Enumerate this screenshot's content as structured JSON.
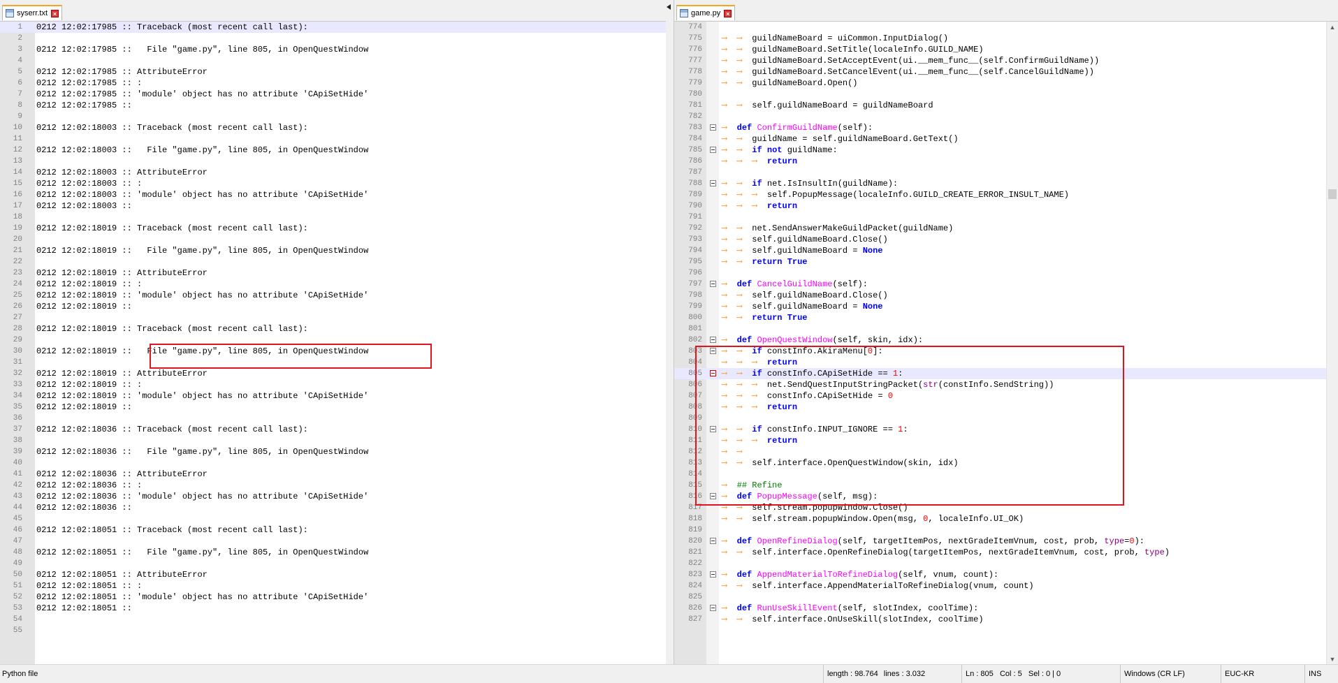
{
  "left_tab": {
    "label": "syserr.txt"
  },
  "right_tab": {
    "label": "game.py"
  },
  "left_lines": [
    {
      "n": "1",
      "t": "0212 12:02:17985 :: Traceback (most recent call last):"
    },
    {
      "n": "2",
      "t": ""
    },
    {
      "n": "3",
      "t": "0212 12:02:17985 ::   File \"game.py\", line 805, in OpenQuestWindow"
    },
    {
      "n": "4",
      "t": ""
    },
    {
      "n": "5",
      "t": "0212 12:02:17985 :: AttributeError"
    },
    {
      "n": "6",
      "t": "0212 12:02:17985 :: :"
    },
    {
      "n": "7",
      "t": "0212 12:02:17985 :: 'module' object has no attribute 'CApiSetHide'"
    },
    {
      "n": "8",
      "t": "0212 12:02:17985 ::"
    },
    {
      "n": "9",
      "t": ""
    },
    {
      "n": "10",
      "t": "0212 12:02:18003 :: Traceback (most recent call last):"
    },
    {
      "n": "11",
      "t": ""
    },
    {
      "n": "12",
      "t": "0212 12:02:18003 ::   File \"game.py\", line 805, in OpenQuestWindow"
    },
    {
      "n": "13",
      "t": ""
    },
    {
      "n": "14",
      "t": "0212 12:02:18003 :: AttributeError"
    },
    {
      "n": "15",
      "t": "0212 12:02:18003 :: :"
    },
    {
      "n": "16",
      "t": "0212 12:02:18003 :: 'module' object has no attribute 'CApiSetHide'"
    },
    {
      "n": "17",
      "t": "0212 12:02:18003 ::"
    },
    {
      "n": "18",
      "t": ""
    },
    {
      "n": "19",
      "t": "0212 12:02:18019 :: Traceback (most recent call last):"
    },
    {
      "n": "20",
      "t": ""
    },
    {
      "n": "21",
      "t": "0212 12:02:18019 ::   File \"game.py\", line 805, in OpenQuestWindow"
    },
    {
      "n": "22",
      "t": ""
    },
    {
      "n": "23",
      "t": "0212 12:02:18019 :: AttributeError"
    },
    {
      "n": "24",
      "t": "0212 12:02:18019 :: :"
    },
    {
      "n": "25",
      "t": "0212 12:02:18019 :: 'module' object has no attribute 'CApiSetHide'"
    },
    {
      "n": "26",
      "t": "0212 12:02:18019 ::"
    },
    {
      "n": "27",
      "t": ""
    },
    {
      "n": "28",
      "t": "0212 12:02:18019 :: Traceback (most recent call last):"
    },
    {
      "n": "29",
      "t": ""
    },
    {
      "n": "30",
      "t": "0212 12:02:18019 ::   File \"game.py\", line 805, in OpenQuestWindow"
    },
    {
      "n": "31",
      "t": ""
    },
    {
      "n": "32",
      "t": "0212 12:02:18019 :: AttributeError"
    },
    {
      "n": "33",
      "t": "0212 12:02:18019 :: :"
    },
    {
      "n": "34",
      "t": "0212 12:02:18019 :: 'module' object has no attribute 'CApiSetHide'"
    },
    {
      "n": "35",
      "t": "0212 12:02:18019 ::"
    },
    {
      "n": "36",
      "t": ""
    },
    {
      "n": "37",
      "t": "0212 12:02:18036 :: Traceback (most recent call last):"
    },
    {
      "n": "38",
      "t": ""
    },
    {
      "n": "39",
      "t": "0212 12:02:18036 ::   File \"game.py\", line 805, in OpenQuestWindow"
    },
    {
      "n": "40",
      "t": ""
    },
    {
      "n": "41",
      "t": "0212 12:02:18036 :: AttributeError"
    },
    {
      "n": "42",
      "t": "0212 12:02:18036 :: :"
    },
    {
      "n": "43",
      "t": "0212 12:02:18036 :: 'module' object has no attribute 'CApiSetHide'"
    },
    {
      "n": "44",
      "t": "0212 12:02:18036 ::"
    },
    {
      "n": "45",
      "t": ""
    },
    {
      "n": "46",
      "t": "0212 12:02:18051 :: Traceback (most recent call last):"
    },
    {
      "n": "47",
      "t": ""
    },
    {
      "n": "48",
      "t": "0212 12:02:18051 ::   File \"game.py\", line 805, in OpenQuestWindow"
    },
    {
      "n": "49",
      "t": ""
    },
    {
      "n": "50",
      "t": "0212 12:02:18051 :: AttributeError"
    },
    {
      "n": "51",
      "t": "0212 12:02:18051 :: :"
    },
    {
      "n": "52",
      "t": "0212 12:02:18051 :: 'module' object has no attribute 'CApiSetHide'"
    },
    {
      "n": "53",
      "t": "0212 12:02:18051 ::"
    },
    {
      "n": "54",
      "t": ""
    },
    {
      "n": "55",
      "t": ""
    }
  ],
  "right_lines": [
    {
      "n": "774",
      "t": ""
    },
    {
      "n": "775",
      "t": "\t\tguildNameBoard = uiCommon.InputDialog()"
    },
    {
      "n": "776",
      "t": "\t\tguildNameBoard.SetTitle(localeInfo.GUILD_NAME)"
    },
    {
      "n": "777",
      "t": "\t\tguildNameBoard.SetAcceptEvent(ui.__mem_func__(self.ConfirmGuildName))"
    },
    {
      "n": "778",
      "t": "\t\tguildNameBoard.SetCancelEvent(ui.__mem_func__(self.CancelGuildName))"
    },
    {
      "n": "779",
      "t": "\t\tguildNameBoard.Open()"
    },
    {
      "n": "780",
      "t": ""
    },
    {
      "n": "781",
      "t": "\t\tself.guildNameBoard = guildNameBoard"
    },
    {
      "n": "782",
      "t": ""
    },
    {
      "n": "783",
      "t": "\tdef ConfirmGuildName(self):",
      "fold": true
    },
    {
      "n": "784",
      "t": "\t\tguildName = self.guildNameBoard.GetText()"
    },
    {
      "n": "785",
      "t": "\t\tif not guildName:",
      "fold": true
    },
    {
      "n": "786",
      "t": "\t\t\treturn"
    },
    {
      "n": "787",
      "t": ""
    },
    {
      "n": "788",
      "t": "\t\tif net.IsInsultIn(guildName):",
      "fold": true
    },
    {
      "n": "789",
      "t": "\t\t\tself.PopupMessage(localeInfo.GUILD_CREATE_ERROR_INSULT_NAME)"
    },
    {
      "n": "790",
      "t": "\t\t\treturn"
    },
    {
      "n": "791",
      "t": ""
    },
    {
      "n": "792",
      "t": "\t\tnet.SendAnswerMakeGuildPacket(guildName)"
    },
    {
      "n": "793",
      "t": "\t\tself.guildNameBoard.Close()"
    },
    {
      "n": "794",
      "t": "\t\tself.guildNameBoard = None"
    },
    {
      "n": "795",
      "t": "\t\treturn True"
    },
    {
      "n": "796",
      "t": ""
    },
    {
      "n": "797",
      "t": "\tdef CancelGuildName(self):",
      "fold": true
    },
    {
      "n": "798",
      "t": "\t\tself.guildNameBoard.Close()"
    },
    {
      "n": "799",
      "t": "\t\tself.guildNameBoard = None"
    },
    {
      "n": "800",
      "t": "\t\treturn True"
    },
    {
      "n": "801",
      "t": ""
    },
    {
      "n": "802",
      "t": "\tdef OpenQuestWindow(self, skin, idx):",
      "fold": true
    },
    {
      "n": "803",
      "t": "\t\tif constInfo.AkiraMenu[0]:",
      "fold": true
    },
    {
      "n": "804",
      "t": "\t\t\treturn"
    },
    {
      "n": "805",
      "t": "\t\tif constInfo.CApiSetHide == 1:",
      "fold": true,
      "red": true,
      "hl": true
    },
    {
      "n": "806",
      "t": "\t\t\tnet.SendQuestInputStringPacket(str(constInfo.SendString))"
    },
    {
      "n": "807",
      "t": "\t\t\tconstInfo.CApiSetHide = 0"
    },
    {
      "n": "808",
      "t": "\t\t\treturn"
    },
    {
      "n": "809",
      "t": ""
    },
    {
      "n": "810",
      "t": "\t\tif constInfo.INPUT_IGNORE == 1:",
      "fold": true
    },
    {
      "n": "811",
      "t": "\t\t\treturn"
    },
    {
      "n": "812",
      "t": "\t\t"
    },
    {
      "n": "813",
      "t": "\t\tself.interface.OpenQuestWindow(skin, idx)"
    },
    {
      "n": "814",
      "t": ""
    },
    {
      "n": "815",
      "t": "\t## Refine"
    },
    {
      "n": "816",
      "t": "\tdef PopupMessage(self, msg):",
      "fold": true
    },
    {
      "n": "817",
      "t": "\t\tself.stream.popupWindow.Close()"
    },
    {
      "n": "818",
      "t": "\t\tself.stream.popupWindow.Open(msg, 0, localeInfo.UI_OK)"
    },
    {
      "n": "819",
      "t": ""
    },
    {
      "n": "820",
      "t": "\tdef OpenRefineDialog(self, targetItemPos, nextGradeItemVnum, cost, prob, type=0):",
      "fold": true
    },
    {
      "n": "821",
      "t": "\t\tself.interface.OpenRefineDialog(targetItemPos, nextGradeItemVnum, cost, prob, type)"
    },
    {
      "n": "822",
      "t": ""
    },
    {
      "n": "823",
      "t": "\tdef AppendMaterialToRefineDialog(self, vnum, count):",
      "fold": true
    },
    {
      "n": "824",
      "t": "\t\tself.interface.AppendMaterialToRefineDialog(vnum, count)"
    },
    {
      "n": "825",
      "t": ""
    },
    {
      "n": "826",
      "t": "\tdef RunUseSkillEvent(self, slotIndex, coolTime):",
      "fold": true
    },
    {
      "n": "827",
      "t": "\t\tself.interface.OnUseSkill(slotIndex, coolTime)"
    }
  ],
  "status": {
    "file_type": "Python file",
    "length": "length : 98.764",
    "lines": "lines : 3.032",
    "ln": "Ln : 805",
    "col": "Col : 5",
    "sel": "Sel : 0 | 0",
    "eol": "Windows (CR LF)",
    "encoding": "EUC-KR",
    "mode": "INS"
  },
  "colors": {
    "keyword": "#0000ff",
    "function": "#ff00ff",
    "number": "#ff0000",
    "comment": "#008000",
    "annotation_box": "#e0141e",
    "tab_accent": "#f5a623"
  }
}
